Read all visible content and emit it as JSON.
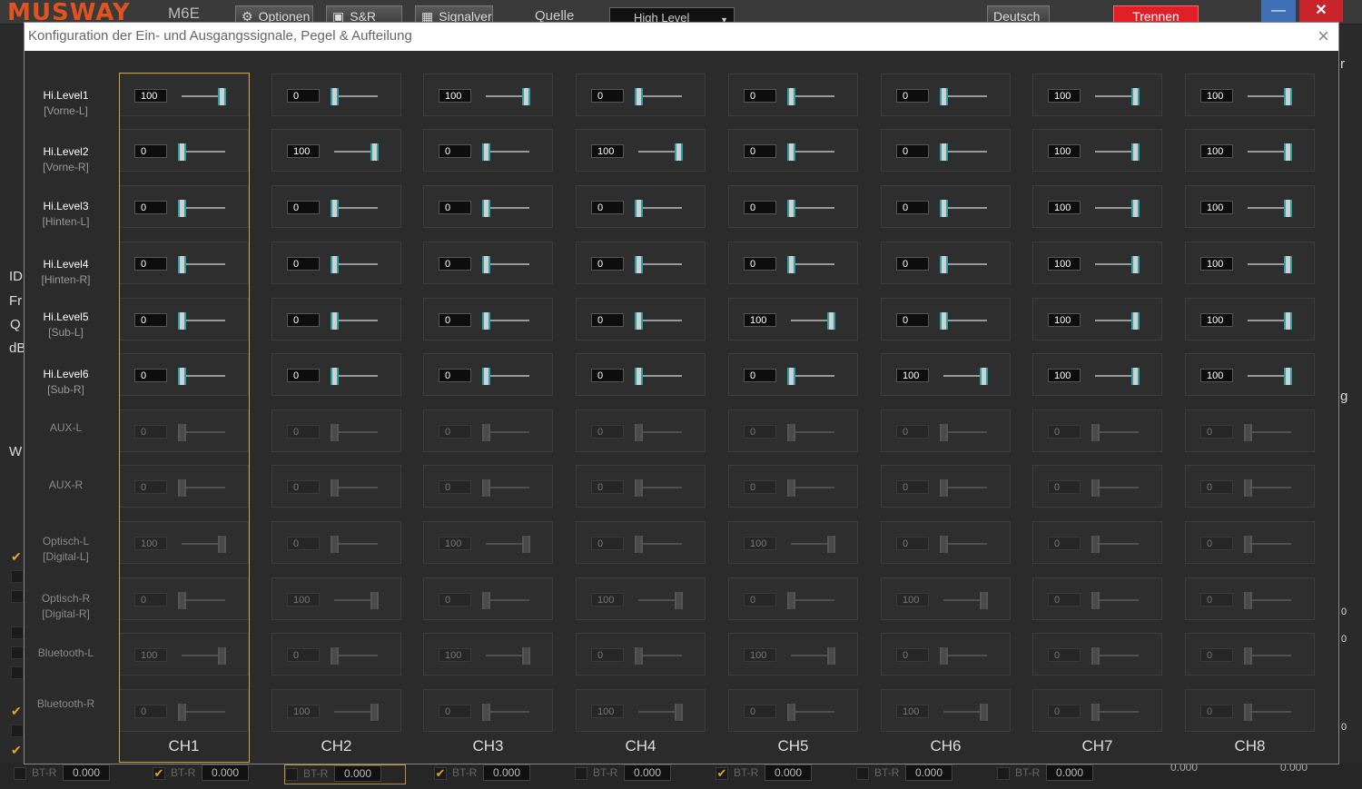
{
  "app": {
    "logo": "MUSWAY",
    "model": "M6E",
    "buttons": {
      "options": "Optionen",
      "sr": "S&R",
      "analyzer": "Signalver",
      "language": "Deutsch",
      "disconnect": "Trennen"
    },
    "source_label": "Quelle",
    "source_value": "High Level"
  },
  "background": {
    "side_letters": [
      "ID",
      "Fr",
      "Q",
      "dB",
      "W"
    ],
    "right_letters": [
      "r",
      "g"
    ],
    "right_values": [
      "0",
      "0",
      "0"
    ]
  },
  "bottom": {
    "items": [
      {
        "label": "BT-R",
        "value": "0.000",
        "checked": false,
        "selected": false
      },
      {
        "label": "BT-R",
        "value": "0.000",
        "checked": true,
        "selected": false
      },
      {
        "label": "BT-R",
        "value": "0.000",
        "checked": false,
        "selected": true
      },
      {
        "label": "BT-R",
        "value": "0.000",
        "checked": true,
        "selected": false
      },
      {
        "label": "BT-R",
        "value": "0.000",
        "checked": false,
        "selected": false
      },
      {
        "label": "BT-R",
        "value": "0.000",
        "checked": true,
        "selected": false
      },
      {
        "label": "BT-R",
        "value": "0.000",
        "checked": false,
        "selected": false
      },
      {
        "label": "BT-R",
        "value": "0.000",
        "checked": false,
        "selected": false
      }
    ],
    "extra_values": [
      "0.000",
      "0.000"
    ]
  },
  "dialog": {
    "title": "Konfiguration der Ein- und Ausgangssignale, Pegel & Aufteilung",
    "close": "×",
    "channels": [
      "CH1",
      "CH2",
      "CH3",
      "CH4",
      "CH5",
      "CH6",
      "CH7",
      "CH8"
    ],
    "selected_channel": "CH1",
    "rows": [
      {
        "name": "Hi.Level1",
        "sub": "[Vorne-L]",
        "enabled": true,
        "values": [
          100,
          0,
          100,
          0,
          0,
          0,
          100,
          100
        ]
      },
      {
        "name": "Hi.Level2",
        "sub": "[Vorne-R]",
        "enabled": true,
        "values": [
          0,
          100,
          0,
          100,
          0,
          0,
          100,
          100
        ]
      },
      {
        "name": "Hi.Level3",
        "sub": "[Hinten-L]",
        "enabled": true,
        "values": [
          0,
          0,
          0,
          0,
          0,
          0,
          100,
          100
        ]
      },
      {
        "name": "Hi.Level4",
        "sub": "[Hinten-R]",
        "enabled": true,
        "values": [
          0,
          0,
          0,
          0,
          0,
          0,
          100,
          100
        ]
      },
      {
        "name": "Hi.Level5",
        "sub": "[Sub-L]",
        "enabled": true,
        "values": [
          0,
          0,
          0,
          0,
          100,
          0,
          100,
          100
        ]
      },
      {
        "name": "Hi.Level6",
        "sub": "[Sub-R]",
        "enabled": true,
        "values": [
          0,
          0,
          0,
          0,
          0,
          100,
          100,
          100
        ]
      },
      {
        "name": "AUX-L",
        "sub": "",
        "enabled": false,
        "values": [
          0,
          0,
          0,
          0,
          0,
          0,
          0,
          0
        ]
      },
      {
        "name": "AUX-R",
        "sub": "",
        "enabled": false,
        "values": [
          0,
          0,
          0,
          0,
          0,
          0,
          0,
          0
        ]
      },
      {
        "name": "Optisch-L",
        "sub": "[Digital-L]",
        "enabled": false,
        "values": [
          100,
          0,
          100,
          0,
          100,
          0,
          0,
          0
        ]
      },
      {
        "name": "Optisch-R",
        "sub": "[Digital-R]",
        "enabled": false,
        "values": [
          0,
          100,
          0,
          100,
          0,
          100,
          0,
          0
        ]
      },
      {
        "name": "Bluetooth-L",
        "sub": "",
        "enabled": false,
        "values": [
          100,
          0,
          100,
          0,
          100,
          0,
          0,
          0
        ]
      },
      {
        "name": "Bluetooth-R",
        "sub": "",
        "enabled": false,
        "values": [
          0,
          100,
          0,
          100,
          0,
          100,
          0,
          0
        ]
      }
    ]
  }
}
